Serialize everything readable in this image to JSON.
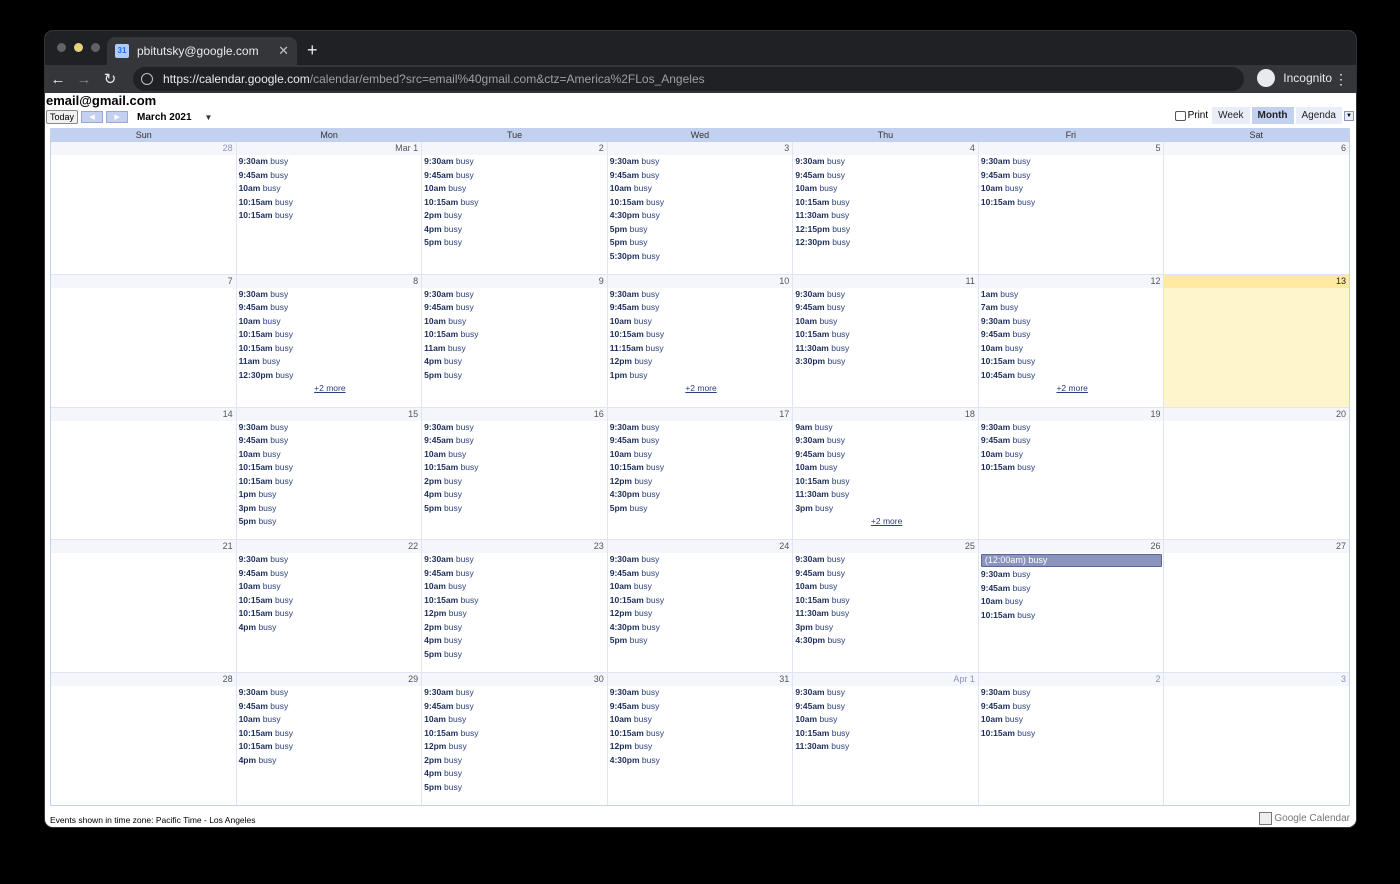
{
  "browser": {
    "tab_title": "pbitutsky@google.com",
    "tab_favicon": "31",
    "url_host": "https://calendar.google.com",
    "url_path": "/calendar/embed?src=email%40gmail.com&ctz=America%2FLos_Angeles",
    "profile_label": "Incognito"
  },
  "calendar": {
    "title": "email@gmail.com",
    "today_label": "Today",
    "month_label": "March 2021",
    "print_label": "Print",
    "views": [
      "Week",
      "Month",
      "Agenda"
    ],
    "active_view": "Month",
    "days_of_week": [
      "Sun",
      "Mon",
      "Tue",
      "Wed",
      "Thu",
      "Fri",
      "Sat"
    ],
    "today_date": "13",
    "weeks": [
      [
        {
          "date": "28",
          "other": true,
          "events": []
        },
        {
          "date": "Mar 1",
          "events": [
            [
              "9:30am",
              "busy"
            ],
            [
              "9:45am",
              "busy"
            ],
            [
              "10am",
              "busy"
            ],
            [
              "10:15am",
              "busy"
            ],
            [
              "10:15am",
              "busy"
            ]
          ]
        },
        {
          "date": "2",
          "events": [
            [
              "9:30am",
              "busy"
            ],
            [
              "9:45am",
              "busy"
            ],
            [
              "10am",
              "busy"
            ],
            [
              "10:15am",
              "busy"
            ],
            [
              "2pm",
              "busy"
            ],
            [
              "4pm",
              "busy"
            ],
            [
              "5pm",
              "busy"
            ]
          ]
        },
        {
          "date": "3",
          "events": [
            [
              "9:30am",
              "busy"
            ],
            [
              "9:45am",
              "busy"
            ],
            [
              "10am",
              "busy"
            ],
            [
              "10:15am",
              "busy"
            ],
            [
              "4:30pm",
              "busy"
            ],
            [
              "5pm",
              "busy"
            ],
            [
              "5pm",
              "busy"
            ],
            [
              "5:30pm",
              "busy"
            ]
          ]
        },
        {
          "date": "4",
          "events": [
            [
              "9:30am",
              "busy"
            ],
            [
              "9:45am",
              "busy"
            ],
            [
              "10am",
              "busy"
            ],
            [
              "10:15am",
              "busy"
            ],
            [
              "11:30am",
              "busy"
            ],
            [
              "12:15pm",
              "busy"
            ],
            [
              "12:30pm",
              "busy"
            ]
          ]
        },
        {
          "date": "5",
          "events": [
            [
              "9:30am",
              "busy"
            ],
            [
              "9:45am",
              "busy"
            ],
            [
              "10am",
              "busy"
            ],
            [
              "10:15am",
              "busy"
            ]
          ]
        },
        {
          "date": "6",
          "events": []
        }
      ],
      [
        {
          "date": "7",
          "events": []
        },
        {
          "date": "8",
          "events": [
            [
              "9:30am",
              "busy"
            ],
            [
              "9:45am",
              "busy"
            ],
            [
              "10am",
              "busy"
            ],
            [
              "10:15am",
              "busy"
            ],
            [
              "10:15am",
              "busy"
            ],
            [
              "11am",
              "busy"
            ],
            [
              "12:30pm",
              "busy"
            ]
          ],
          "more": "+2 more"
        },
        {
          "date": "9",
          "events": [
            [
              "9:30am",
              "busy"
            ],
            [
              "9:45am",
              "busy"
            ],
            [
              "10am",
              "busy"
            ],
            [
              "10:15am",
              "busy"
            ],
            [
              "11am",
              "busy"
            ],
            [
              "4pm",
              "busy"
            ],
            [
              "5pm",
              "busy"
            ]
          ]
        },
        {
          "date": "10",
          "events": [
            [
              "9:30am",
              "busy"
            ],
            [
              "9:45am",
              "busy"
            ],
            [
              "10am",
              "busy"
            ],
            [
              "10:15am",
              "busy"
            ],
            [
              "11:15am",
              "busy"
            ],
            [
              "12pm",
              "busy"
            ],
            [
              "1pm",
              "busy"
            ]
          ],
          "more": "+2 more"
        },
        {
          "date": "11",
          "events": [
            [
              "9:30am",
              "busy"
            ],
            [
              "9:45am",
              "busy"
            ],
            [
              "10am",
              "busy"
            ],
            [
              "10:15am",
              "busy"
            ],
            [
              "11:30am",
              "busy"
            ],
            [
              "3:30pm",
              "busy"
            ]
          ]
        },
        {
          "date": "12",
          "events": [
            [
              "1am",
              "busy"
            ],
            [
              "7am",
              "busy"
            ],
            [
              "9:30am",
              "busy"
            ],
            [
              "9:45am",
              "busy"
            ],
            [
              "10am",
              "busy"
            ],
            [
              "10:15am",
              "busy"
            ],
            [
              "10:45am",
              "busy"
            ]
          ],
          "more": "+2 more"
        },
        {
          "date": "13",
          "today": true,
          "events": []
        }
      ],
      [
        {
          "date": "14",
          "events": []
        },
        {
          "date": "15",
          "events": [
            [
              "9:30am",
              "busy"
            ],
            [
              "9:45am",
              "busy"
            ],
            [
              "10am",
              "busy"
            ],
            [
              "10:15am",
              "busy"
            ],
            [
              "10:15am",
              "busy"
            ],
            [
              "1pm",
              "busy"
            ],
            [
              "3pm",
              "busy"
            ],
            [
              "5pm",
              "busy"
            ]
          ]
        },
        {
          "date": "16",
          "events": [
            [
              "9:30am",
              "busy"
            ],
            [
              "9:45am",
              "busy"
            ],
            [
              "10am",
              "busy"
            ],
            [
              "10:15am",
              "busy"
            ],
            [
              "2pm",
              "busy"
            ],
            [
              "4pm",
              "busy"
            ],
            [
              "5pm",
              "busy"
            ]
          ]
        },
        {
          "date": "17",
          "events": [
            [
              "9:30am",
              "busy"
            ],
            [
              "9:45am",
              "busy"
            ],
            [
              "10am",
              "busy"
            ],
            [
              "10:15am",
              "busy"
            ],
            [
              "12pm",
              "busy"
            ],
            [
              "4:30pm",
              "busy"
            ],
            [
              "5pm",
              "busy"
            ]
          ]
        },
        {
          "date": "18",
          "events": [
            [
              "9am",
              "busy"
            ],
            [
              "9:30am",
              "busy"
            ],
            [
              "9:45am",
              "busy"
            ],
            [
              "10am",
              "busy"
            ],
            [
              "10:15am",
              "busy"
            ],
            [
              "11:30am",
              "busy"
            ],
            [
              "3pm",
              "busy"
            ]
          ],
          "more": "+2 more"
        },
        {
          "date": "19",
          "events": [
            [
              "9:30am",
              "busy"
            ],
            [
              "9:45am",
              "busy"
            ],
            [
              "10am",
              "busy"
            ],
            [
              "10:15am",
              "busy"
            ]
          ]
        },
        {
          "date": "20",
          "events": []
        }
      ],
      [
        {
          "date": "21",
          "events": []
        },
        {
          "date": "22",
          "events": [
            [
              "9:30am",
              "busy"
            ],
            [
              "9:45am",
              "busy"
            ],
            [
              "10am",
              "busy"
            ],
            [
              "10:15am",
              "busy"
            ],
            [
              "10:15am",
              "busy"
            ],
            [
              "4pm",
              "busy"
            ]
          ]
        },
        {
          "date": "23",
          "events": [
            [
              "9:30am",
              "busy"
            ],
            [
              "9:45am",
              "busy"
            ],
            [
              "10am",
              "busy"
            ],
            [
              "10:15am",
              "busy"
            ],
            [
              "12pm",
              "busy"
            ],
            [
              "2pm",
              "busy"
            ],
            [
              "4pm",
              "busy"
            ],
            [
              "5pm",
              "busy"
            ]
          ]
        },
        {
          "date": "24",
          "events": [
            [
              "9:30am",
              "busy"
            ],
            [
              "9:45am",
              "busy"
            ],
            [
              "10am",
              "busy"
            ],
            [
              "10:15am",
              "busy"
            ],
            [
              "12pm",
              "busy"
            ],
            [
              "4:30pm",
              "busy"
            ],
            [
              "5pm",
              "busy"
            ]
          ]
        },
        {
          "date": "25",
          "events": [
            [
              "9:30am",
              "busy"
            ],
            [
              "9:45am",
              "busy"
            ],
            [
              "10am",
              "busy"
            ],
            [
              "10:15am",
              "busy"
            ],
            [
              "11:30am",
              "busy"
            ],
            [
              "3pm",
              "busy"
            ],
            [
              "4:30pm",
              "busy"
            ]
          ]
        },
        {
          "date": "26",
          "allday": "(12:00am) busy",
          "events": [
            [
              "9:30am",
              "busy"
            ],
            [
              "9:45am",
              "busy"
            ],
            [
              "10am",
              "busy"
            ],
            [
              "10:15am",
              "busy"
            ]
          ]
        },
        {
          "date": "27",
          "events": []
        }
      ],
      [
        {
          "date": "28",
          "events": []
        },
        {
          "date": "29",
          "events": [
            [
              "9:30am",
              "busy"
            ],
            [
              "9:45am",
              "busy"
            ],
            [
              "10am",
              "busy"
            ],
            [
              "10:15am",
              "busy"
            ],
            [
              "10:15am",
              "busy"
            ],
            [
              "4pm",
              "busy"
            ]
          ]
        },
        {
          "date": "30",
          "events": [
            [
              "9:30am",
              "busy"
            ],
            [
              "9:45am",
              "busy"
            ],
            [
              "10am",
              "busy"
            ],
            [
              "10:15am",
              "busy"
            ],
            [
              "12pm",
              "busy"
            ],
            [
              "2pm",
              "busy"
            ],
            [
              "4pm",
              "busy"
            ],
            [
              "5pm",
              "busy"
            ]
          ]
        },
        {
          "date": "31",
          "events": [
            [
              "9:30am",
              "busy"
            ],
            [
              "9:45am",
              "busy"
            ],
            [
              "10am",
              "busy"
            ],
            [
              "10:15am",
              "busy"
            ],
            [
              "12pm",
              "busy"
            ],
            [
              "4:30pm",
              "busy"
            ]
          ]
        },
        {
          "date": "Apr 1",
          "other": true,
          "events": [
            [
              "9:30am",
              "busy"
            ],
            [
              "9:45am",
              "busy"
            ],
            [
              "10am",
              "busy"
            ],
            [
              "10:15am",
              "busy"
            ],
            [
              "11:30am",
              "busy"
            ]
          ]
        },
        {
          "date": "2",
          "other": true,
          "events": [
            [
              "9:30am",
              "busy"
            ],
            [
              "9:45am",
              "busy"
            ],
            [
              "10am",
              "busy"
            ],
            [
              "10:15am",
              "busy"
            ]
          ]
        },
        {
          "date": "3",
          "other": true,
          "events": []
        }
      ]
    ],
    "footer_timezone": "Events shown in time zone: Pacific Time - Los Angeles",
    "branding": "Google Calendar"
  }
}
